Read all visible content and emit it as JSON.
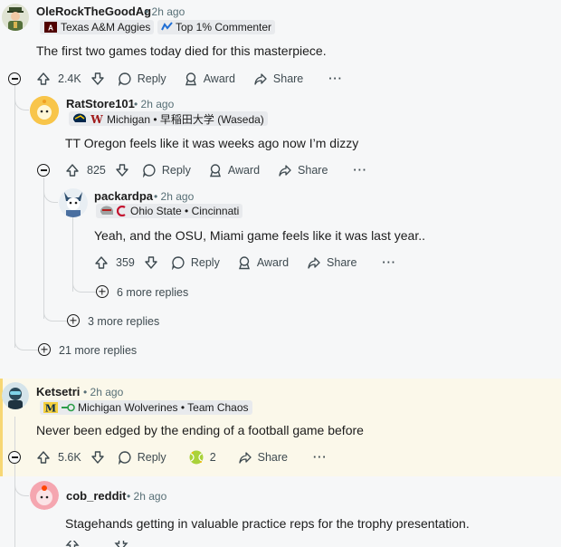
{
  "comments": {
    "c1": {
      "user": "OleRockTheGoodAg",
      "time": "2h ago",
      "flair1": "Texas A&M Aggies",
      "flair2": "Top 1% Commenter",
      "text": "The first two games today died for this masterpiece.",
      "votes": "2.4K",
      "reply": "Reply",
      "award": "Award",
      "share": "Share",
      "more": "···"
    },
    "c2": {
      "user": "RatStore101",
      "time": "2h ago",
      "flair": "Michigan • 早稲田大学 (Waseda)",
      "text": "TT Oregon feels like it was weeks ago now I’m dizzy",
      "votes": "825",
      "reply": "Reply",
      "award": "Award",
      "share": "Share",
      "more": "···"
    },
    "c3": {
      "user": "packardpa",
      "time": "2h ago",
      "flair": "Ohio State • Cincinnati",
      "text": "Yeah, and the OSU, Miami game feels like it was last year..",
      "votes": "359",
      "reply": "Reply",
      "award": "Award",
      "share": "Share",
      "more": "···"
    },
    "c4": {
      "user": "Ketsetri",
      "time": "2h ago",
      "flair": "Michigan Wolverines • Team Chaos",
      "text": "Never been edged by the ending of a football game before",
      "votes": "5.6K",
      "reply": "Reply",
      "award_count": "2",
      "share": "Share",
      "more": "···"
    },
    "c5": {
      "user": "cob_reddit",
      "time": "2h ago",
      "text": "Stagehands getting in valuable practice reps for the trophy presentation."
    }
  },
  "more_replies": {
    "r6": "6 more replies",
    "r3": "3 more replies",
    "r21": "21 more replies"
  },
  "separator": "•",
  "icons": {
    "upvote": "arrow-up-icon",
    "downvote": "arrow-down-icon",
    "reply": "speech-bubble-icon",
    "award": "award-icon",
    "share": "share-arrow-icon"
  },
  "colors": {
    "highlight_bg": "#fbf8ea",
    "highlight_border": "#f7d774",
    "line": "#d4d7d9",
    "meta": "#576f76"
  }
}
